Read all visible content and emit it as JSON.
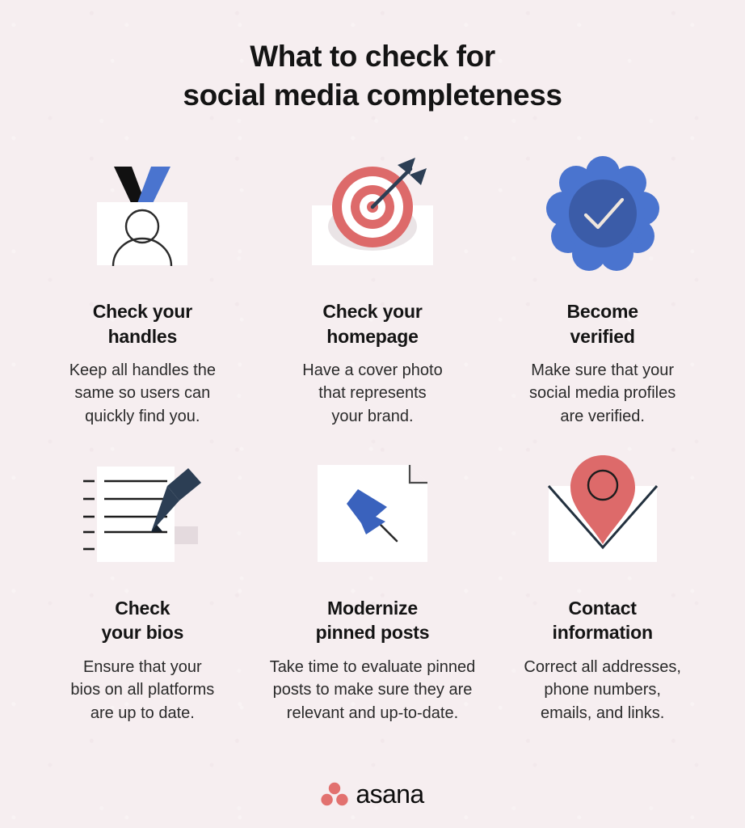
{
  "theme": {
    "background": "#f6eef0",
    "text": "#141414",
    "coral": "#dd6a6a",
    "blue": "#4a74cf",
    "blue_dark": "#3b5ca8",
    "navy": "#2c3e54",
    "black": "#111111",
    "white": "#ffffff"
  },
  "title": {
    "line1": "What to check for",
    "line2": "social media completeness"
  },
  "cards": [
    {
      "icon": "id-card-check-icon",
      "heading_line1": "Check your",
      "heading_line2": "handles",
      "body_line1": "Keep all handles the",
      "body_line2": "same so users can",
      "body_line3": "quickly find you."
    },
    {
      "icon": "target-arrow-icon",
      "heading_line1": "Check your",
      "heading_line2": "homepage",
      "body_line1": "Have a cover photo",
      "body_line2": "that represents",
      "body_line3": "your brand."
    },
    {
      "icon": "verified-badge-icon",
      "heading_line1": "Become",
      "heading_line2": "verified",
      "body_line1": "Make sure that your",
      "body_line2": "social media profiles",
      "body_line3": "are verified."
    },
    {
      "icon": "document-pencil-icon",
      "heading_line1": "Check",
      "heading_line2": "your bios",
      "body_line1": "Ensure that your",
      "body_line2": "bios on all platforms",
      "body_line3": "are up to date."
    },
    {
      "icon": "pushpin-note-icon",
      "heading_line1": "Modernize",
      "heading_line2": "pinned posts",
      "body_line1": "Take time to evaluate pinned",
      "body_line2": "posts to make sure they are",
      "body_line3": "relevant and up-to-date."
    },
    {
      "icon": "envelope-map-pin-icon",
      "heading_line1": "Contact",
      "heading_line2": "information",
      "body_line1": "Correct all addresses,",
      "body_line2": "phone numbers,",
      "body_line3": "emails, and links."
    }
  ],
  "footer": {
    "logo_mark": "asana-dots-logo",
    "logo_text": "asana"
  }
}
